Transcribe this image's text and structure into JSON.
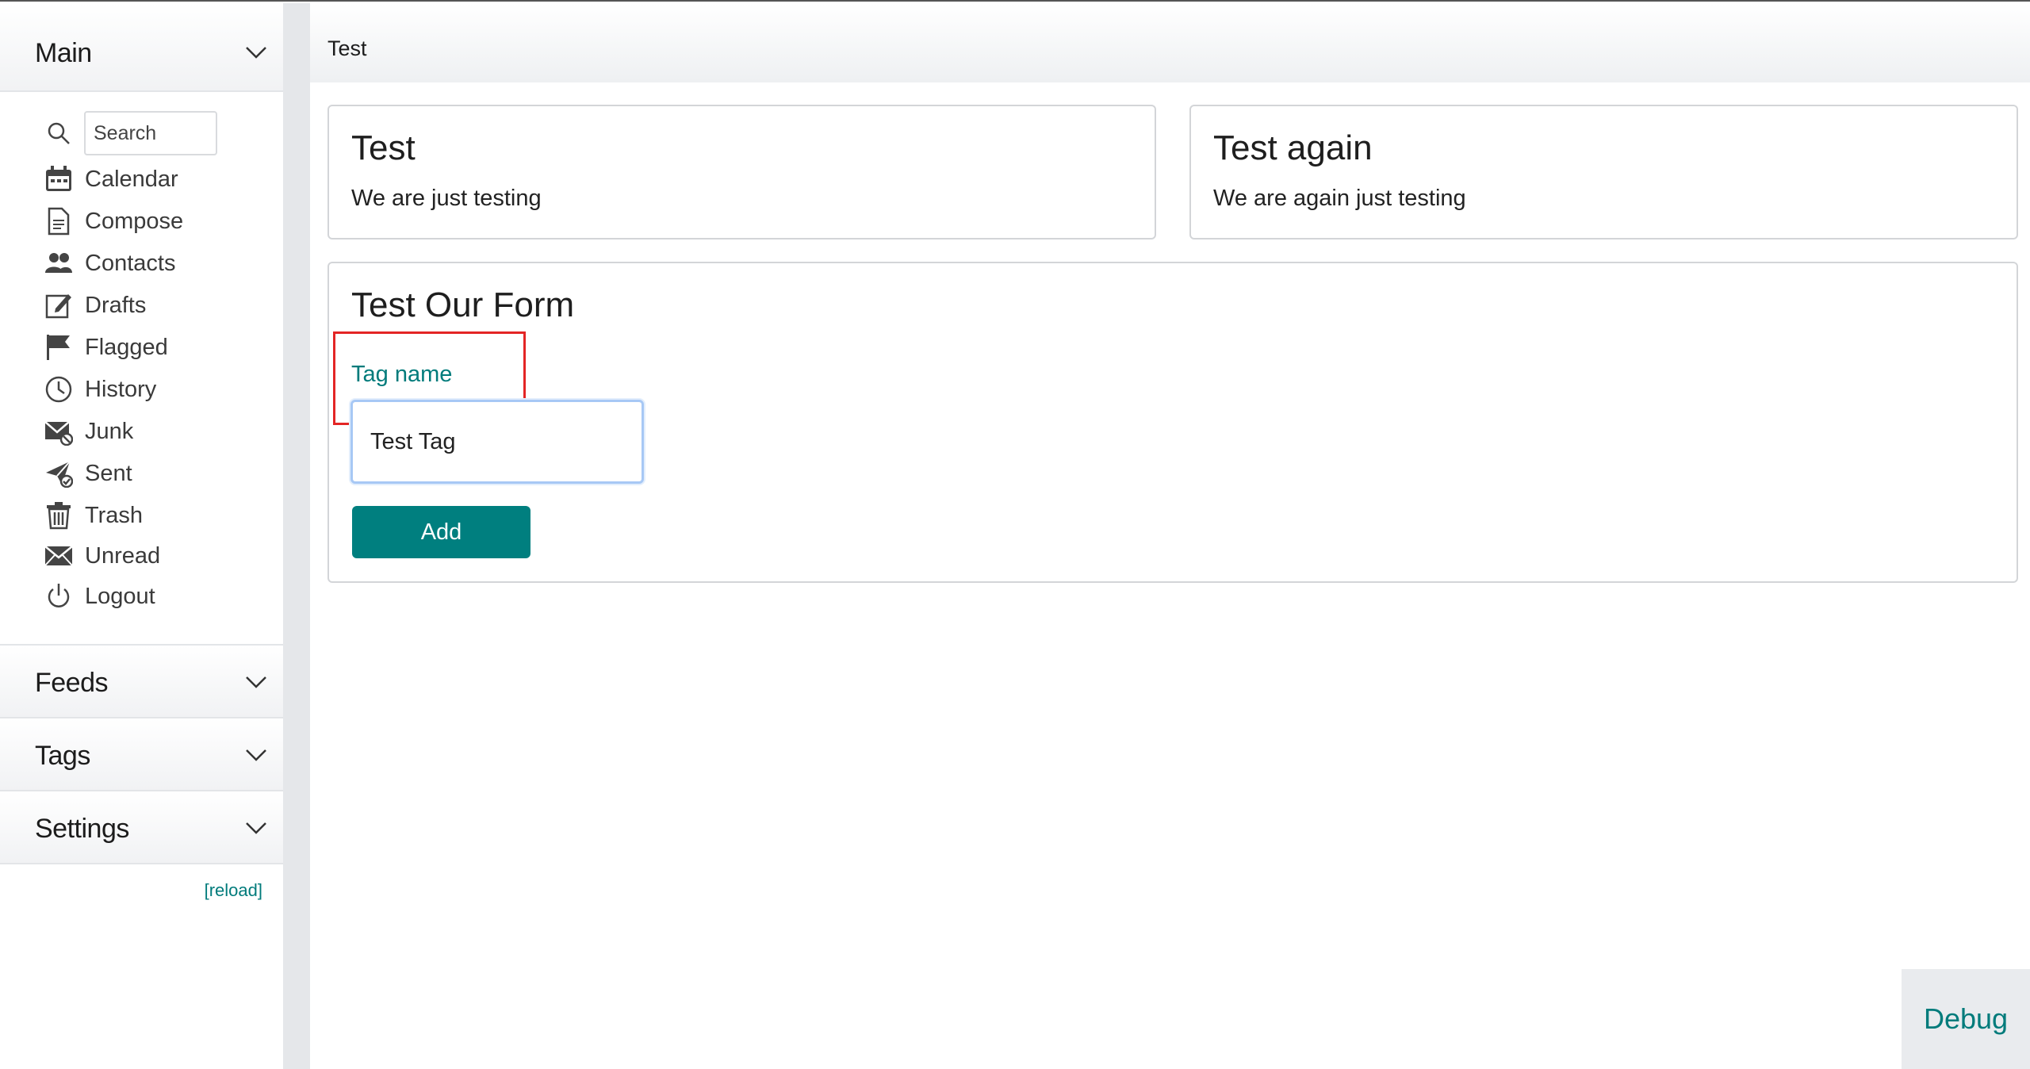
{
  "sidebar": {
    "sections": {
      "main": "Main",
      "feeds": "Feeds",
      "tags": "Tags",
      "settings": "Settings"
    },
    "search_placeholder": "Search",
    "items": [
      {
        "label": "Calendar",
        "icon": "calendar-icon"
      },
      {
        "label": "Compose",
        "icon": "document-icon"
      },
      {
        "label": "Contacts",
        "icon": "people-icon"
      },
      {
        "label": "Drafts",
        "icon": "edit-icon"
      },
      {
        "label": "Flagged",
        "icon": "flag-icon"
      },
      {
        "label": "History",
        "icon": "clock-icon"
      },
      {
        "label": "Junk",
        "icon": "junk-mail-icon"
      },
      {
        "label": "Sent",
        "icon": "sent-icon"
      },
      {
        "label": "Trash",
        "icon": "trash-icon"
      },
      {
        "label": "Unread",
        "icon": "envelope-icon"
      },
      {
        "label": "Logout",
        "icon": "power-icon"
      }
    ],
    "reload": "[reload]"
  },
  "header": {
    "title": "Test"
  },
  "cards": [
    {
      "title": "Test",
      "text": "We are just testing"
    },
    {
      "title": "Test again",
      "text": "We are again just testing"
    }
  ],
  "form": {
    "title": "Test Our Form",
    "label": "Tag name",
    "value": "Test Tag",
    "button": "Add"
  },
  "debug": "Debug",
  "colors": {
    "accent": "#007f7f",
    "highlight": "#e32525"
  }
}
